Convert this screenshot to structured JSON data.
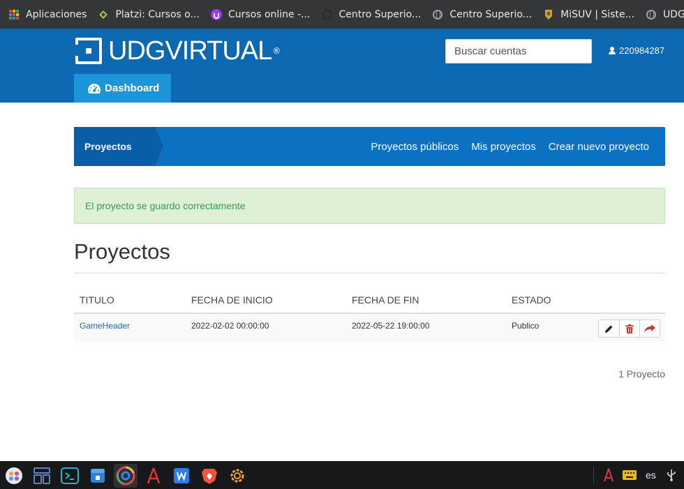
{
  "bookmarks": [
    {
      "label": "Aplicaciones",
      "icon": "apps-grid-icon"
    },
    {
      "label": "Platzi: Cursos o...",
      "icon": "platzi-icon"
    },
    {
      "label": "Cursos online -...",
      "icon": "udemy-icon"
    },
    {
      "label": "Centro Superio...",
      "icon": "github-icon"
    },
    {
      "label": "Centro Superio...",
      "icon": "globe-icon"
    },
    {
      "label": "MiSUV | Siste...",
      "icon": "udg-seal-icon"
    },
    {
      "label": "UDG Virtu",
      "icon": "globe-icon"
    }
  ],
  "header": {
    "logo_text": "UDGVIRTUAL",
    "logo_reg": "®",
    "search_placeholder": "Buscar cuentas",
    "user_id": "220984287",
    "dashboard_label": "Dashboard"
  },
  "subnav": {
    "title": "Proyectos",
    "links": [
      "Proyectos públicos",
      "Mis proyectos",
      "Crear nuevo proyecto"
    ]
  },
  "alert": {
    "message": "El proyecto se guardo correctamente",
    "color": "#3c9a45"
  },
  "page": {
    "title": "Proyectos",
    "count_text": "1 Proyecto"
  },
  "table": {
    "columns": [
      "TITULO",
      "FECHA DE INICIO",
      "FECHA DE FIN",
      "ESTADO"
    ],
    "rows": [
      {
        "titulo": "GameHeader",
        "inicio": "2022-02-02 00:00:00",
        "fin": "2022-05-22 19:00:00",
        "estado": "Publico",
        "actions": [
          "edit-icon",
          "delete-icon",
          "share-icon"
        ]
      }
    ]
  },
  "taskbar": {
    "apps": [
      "launcher-icon",
      "workspaces-icon",
      "terminal-icon",
      "store-icon",
      "chrome-icon",
      "acrobat-icon",
      "wps-writer-icon",
      "brave-icon",
      "settings-icon"
    ],
    "tray": {
      "lang": "es"
    }
  },
  "colors": {
    "header_blue": "#0b68b1",
    "dashboard_tab": "#1b95d6",
    "subnav_blue": "#0b72c3"
  }
}
